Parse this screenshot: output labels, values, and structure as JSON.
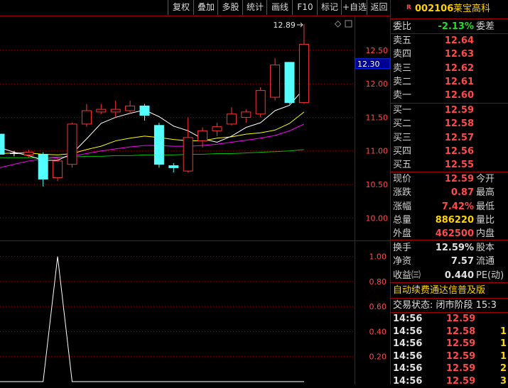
{
  "toolbar": {
    "buttons": [
      "复权",
      "叠加",
      "多股",
      "统计",
      "画线",
      "F10",
      "标记",
      "+自选",
      "返回"
    ]
  },
  "stock": {
    "badge": "R",
    "code": "002106",
    "name": "莱宝高科"
  },
  "main_chart": {
    "price_ticks": [
      "12.50",
      "12.00",
      "11.50",
      "11.00",
      "10.50",
      "10.00"
    ],
    "current_price_tag": "12.30",
    "high_marker": "12.89",
    "corner_glyph": "◇"
  },
  "sub_chart": {
    "ticks": [
      "1.00",
      "0.80",
      "0.60",
      "0.40",
      "0.20"
    ]
  },
  "quote": {
    "weibi_label": "委比",
    "weibi_value": "-2.13%",
    "weicha_label": "委差",
    "sell": [
      {
        "label": "卖五",
        "price": "12.64"
      },
      {
        "label": "卖四",
        "price": "12.63"
      },
      {
        "label": "卖三",
        "price": "12.62"
      },
      {
        "label": "卖二",
        "price": "12.61"
      },
      {
        "label": "卖一",
        "price": "12.60"
      }
    ],
    "buy": [
      {
        "label": "买一",
        "price": "12.59"
      },
      {
        "label": "买二",
        "price": "12.58"
      },
      {
        "label": "买三",
        "price": "12.57"
      },
      {
        "label": "买四",
        "price": "12.56"
      },
      {
        "label": "买五",
        "price": "12.55"
      }
    ],
    "stats": [
      {
        "label": "现价",
        "value": "12.59",
        "right": "今开"
      },
      {
        "label": "涨跌",
        "value": "0.87",
        "right": "最高"
      },
      {
        "label": "涨幅",
        "value": "7.42%",
        "right": "最低"
      },
      {
        "label": "总量",
        "value": "886220",
        "right": "量比"
      },
      {
        "label": "外盘",
        "value": "462500",
        "right": "内盘"
      }
    ],
    "fin": [
      {
        "label": "换手",
        "value": "12.59%",
        "right": "股本"
      },
      {
        "label": "净资",
        "value": "7.57",
        "right": "流通"
      },
      {
        "label": "收益㈢",
        "value": "0.440",
        "right": "PE(动)"
      }
    ],
    "banner": "自动续费通达信普及版",
    "trade_status": "交易状态: 闭市阶段 15:3"
  },
  "ticks": [
    {
      "time": "14:56",
      "price": "12.59",
      "vol": ""
    },
    {
      "time": "14:56",
      "price": "12.58",
      "vol": "1"
    },
    {
      "time": "14:56",
      "price": "12.59",
      "vol": "1"
    },
    {
      "time": "14:56",
      "price": "12.59",
      "vol": "1"
    },
    {
      "time": "14:56",
      "price": "12.59",
      "vol": "2"
    },
    {
      "time": "14:56",
      "price": "12.59",
      "vol": "3"
    }
  ],
  "chart_data": {
    "type": "candlestick",
    "ylim": [
      9.75,
      12.9
    ],
    "candles": [
      {
        "o": 11.25,
        "h": 11.3,
        "l": 10.9,
        "c": 10.95,
        "dir": "down"
      },
      {
        "o": 10.96,
        "h": 11.0,
        "l": 10.92,
        "c": 10.95,
        "dir": "flat"
      },
      {
        "o": 10.94,
        "h": 11.02,
        "l": 10.9,
        "c": 10.98,
        "dir": "up"
      },
      {
        "o": 10.95,
        "h": 10.98,
        "l": 10.47,
        "c": 10.58,
        "dir": "down"
      },
      {
        "o": 10.6,
        "h": 10.9,
        "l": 10.55,
        "c": 10.85,
        "dir": "up"
      },
      {
        "o": 10.8,
        "h": 11.42,
        "l": 10.75,
        "c": 11.4,
        "dir": "up"
      },
      {
        "o": 11.4,
        "h": 11.7,
        "l": 11.36,
        "c": 11.6,
        "dir": "up"
      },
      {
        "o": 11.58,
        "h": 11.7,
        "l": 11.55,
        "c": 11.62,
        "dir": "up"
      },
      {
        "o": 11.58,
        "h": 11.75,
        "l": 11.5,
        "c": 11.62,
        "dir": "up"
      },
      {
        "o": 11.6,
        "h": 11.75,
        "l": 11.55,
        "c": 11.67,
        "dir": "up"
      },
      {
        "o": 11.67,
        "h": 11.7,
        "l": 11.45,
        "c": 11.53,
        "dir": "down"
      },
      {
        "o": 11.38,
        "h": 11.42,
        "l": 10.75,
        "c": 10.8,
        "dir": "down"
      },
      {
        "o": 10.78,
        "h": 10.82,
        "l": 10.68,
        "c": 10.75,
        "dir": "down"
      },
      {
        "o": 10.7,
        "h": 11.5,
        "l": 10.68,
        "c": 11.2,
        "dir": "up"
      },
      {
        "o": 11.15,
        "h": 11.35,
        "l": 11.05,
        "c": 11.3,
        "dir": "up"
      },
      {
        "o": 11.3,
        "h": 11.42,
        "l": 11.22,
        "c": 11.36,
        "dir": "up"
      },
      {
        "o": 11.4,
        "h": 11.65,
        "l": 11.38,
        "c": 11.55,
        "dir": "up"
      },
      {
        "o": 11.5,
        "h": 11.62,
        "l": 11.42,
        "c": 11.58,
        "dir": "up"
      },
      {
        "o": 11.55,
        "h": 11.95,
        "l": 11.5,
        "c": 11.9,
        "dir": "up"
      },
      {
        "o": 11.8,
        "h": 12.38,
        "l": 11.75,
        "c": 12.28,
        "dir": "up"
      },
      {
        "o": 12.32,
        "h": 12.32,
        "l": 11.7,
        "c": 11.72,
        "dir": "down"
      },
      {
        "o": 11.72,
        "h": 12.89,
        "l": 11.7,
        "c": 12.59,
        "dir": "up"
      }
    ],
    "ma_white": [
      11.05,
      10.98,
      10.93,
      10.86,
      10.86,
      10.96,
      11.18,
      11.41,
      11.5,
      11.56,
      11.61,
      11.51,
      11.37,
      11.3,
      11.18,
      11.13,
      11.22,
      11.35,
      11.42,
      11.6,
      11.68,
      11.93
    ],
    "ma_yellow": [
      10.96,
      10.97,
      10.97,
      10.95,
      10.94,
      10.96,
      11.02,
      11.07,
      11.15,
      11.19,
      11.22,
      11.2,
      11.17,
      11.15,
      11.15,
      11.19,
      11.21,
      11.25,
      11.27,
      11.31,
      11.41,
      11.58
    ],
    "ma_magenta": [
      10.75,
      10.8,
      10.85,
      10.88,
      10.9,
      10.92,
      10.96,
      11.0,
      11.03,
      11.06,
      11.08,
      11.08,
      11.07,
      11.07,
      11.08,
      11.1,
      11.13,
      11.16,
      11.19,
      11.23,
      11.3,
      11.4
    ],
    "ma_green": [
      10.9,
      10.9,
      10.9,
      10.9,
      10.91,
      10.91,
      10.92,
      10.92,
      10.93,
      10.93,
      10.94,
      10.94,
      10.94,
      10.95,
      10.95,
      10.96,
      10.96,
      10.97,
      10.98,
      10.99,
      11.0,
      11.02
    ],
    "sub": {
      "ylim": [
        0,
        1.1
      ],
      "values": [
        0,
        0,
        0,
        0,
        1,
        0,
        0,
        0,
        0,
        0,
        0,
        0,
        0,
        0,
        0,
        0,
        0,
        0,
        0,
        0,
        0,
        0
      ]
    }
  },
  "colors": {
    "frame": "#a00000",
    "up": "#ff3232",
    "down": "#54ffff",
    "white_ma": "#ffffff",
    "yellow_ma": "#ffff00",
    "magenta_ma": "#ff00ff",
    "green_ma": "#00c000"
  }
}
